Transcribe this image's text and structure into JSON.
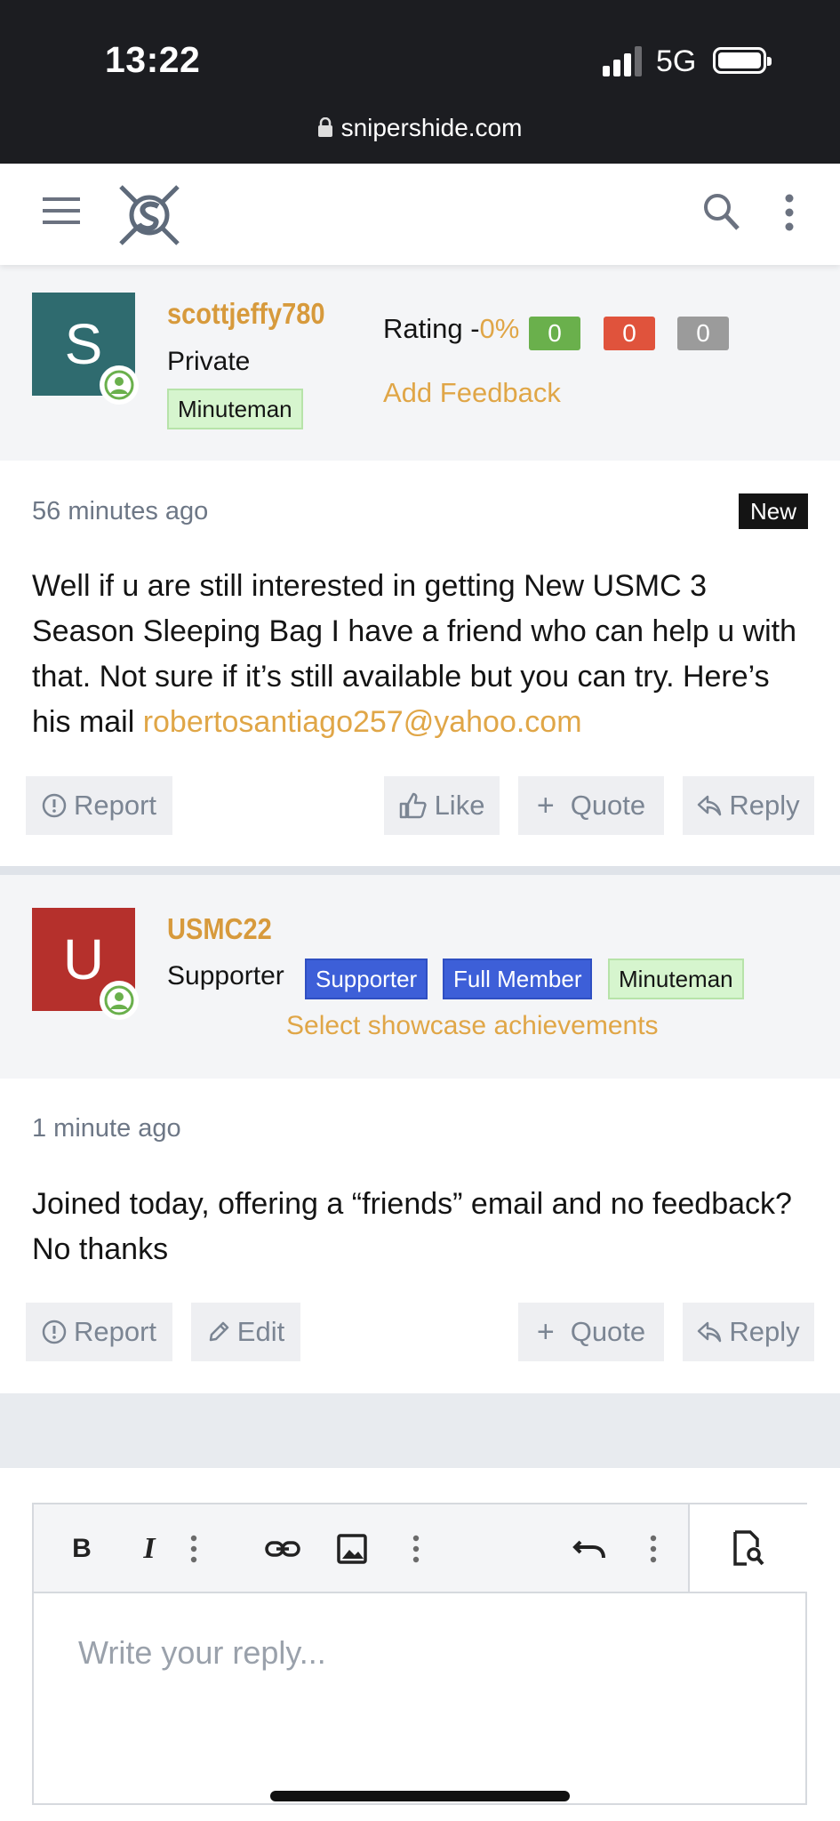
{
  "status": {
    "time": "13:22",
    "network": "5G",
    "url": "snipershide.com"
  },
  "post1": {
    "avatar_letter": "S",
    "avatar_color": "#2f6b6f",
    "username": "scottjeffy780",
    "title": "Private",
    "badge": "Minuteman",
    "rating_label": "Rating -",
    "rating_pct": "0%",
    "feedback_counts": [
      "0",
      "0",
      "0"
    ],
    "feedback_colors": [
      "#6ab04c",
      "#e0533c",
      "#9b9b9b"
    ],
    "add_feedback": "Add Feedback",
    "time": "56 minutes ago",
    "new_label": "New",
    "text": "Well if u are still interested in getting New USMC 3 Season Sleeping Bag I have a friend who can help u with that. Not sure if it’s still available but you can try. Here’s his mail ",
    "email": "robertosantiago257@yahoo.com",
    "actions": {
      "report": "Report",
      "like": "Like",
      "quote": "Quote",
      "reply": "Reply"
    }
  },
  "post2": {
    "avatar_letter": "U",
    "avatar_color": "#b5302c",
    "username": "USMC22",
    "title": "Supporter",
    "badges": [
      "Supporter",
      "Full Member",
      "Minuteman"
    ],
    "showcase": "Select showcase achievements",
    "time": "1 minute ago",
    "text": "Joined today, offering a “friends” email and no feedback? No thanks",
    "actions": {
      "report": "Report",
      "edit": "Edit",
      "quote": "Quote",
      "reply": "Reply"
    }
  },
  "editor": {
    "placeholder": "Write your reply..."
  },
  "colors": {
    "accent": "#d79a3c",
    "link": "#e0a647",
    "badge_blue": "#3d5fd8",
    "badge_green": "#d6f5ce"
  }
}
